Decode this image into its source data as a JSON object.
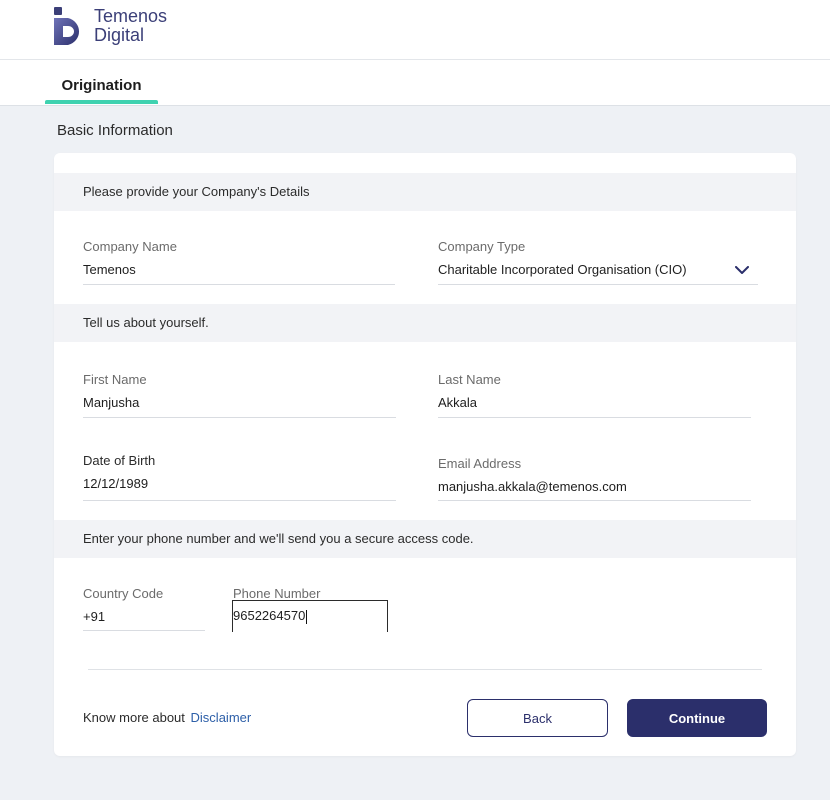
{
  "brand": {
    "name_line1": "Temenos",
    "name_line2": "Digital",
    "logo_color": "#3b3f78"
  },
  "tabs": [
    {
      "label": "Origination",
      "active": true
    }
  ],
  "page": {
    "section_title": "Basic Information"
  },
  "company_section": {
    "heading": "Please provide your Company's Details",
    "company_name": {
      "label": "Company Name",
      "value": "Temenos"
    },
    "company_type": {
      "label": "Company Type",
      "value": "Charitable Incorporated Organisation (CIO)"
    }
  },
  "personal_section": {
    "heading": "Tell us about yourself.",
    "first_name": {
      "label": "First Name",
      "value": "Manjusha"
    },
    "last_name": {
      "label": "Last Name",
      "value": "Akkala"
    },
    "dob": {
      "label": "Date of Birth",
      "value": "12/12/1989"
    },
    "email": {
      "label": "Email Address",
      "value": "manjusha.akkala@temenos.com"
    }
  },
  "phone_section": {
    "heading": "Enter your phone number and we'll send you a secure access code.",
    "country_code": {
      "label": "Country Code",
      "value": "+91"
    },
    "phone_number": {
      "label": "Phone Number",
      "value": "9652264570"
    }
  },
  "footer": {
    "know_more": "Know more about",
    "disclaimer_link": "Disclaimer",
    "back_label": "Back",
    "continue_label": "Continue"
  },
  "colors": {
    "accent": "#3fd2b0",
    "primary": "#2b2f6b",
    "link": "#2d5fa8"
  },
  "icons": {
    "logo": "temenos-d-logo-icon",
    "dropdown": "chevron-down-icon"
  }
}
